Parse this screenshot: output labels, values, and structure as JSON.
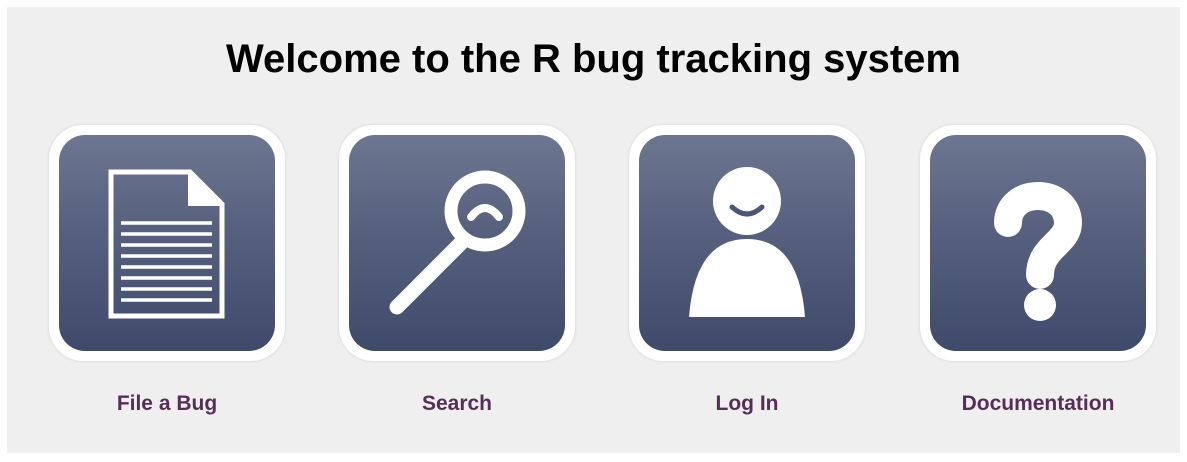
{
  "page": {
    "title": "Welcome to the R bug tracking system"
  },
  "tiles": [
    {
      "label": "File a Bug",
      "icon": "document-icon"
    },
    {
      "label": "Search",
      "icon": "magnifier-icon"
    },
    {
      "label": "Log In",
      "icon": "user-icon"
    },
    {
      "label": "Documentation",
      "icon": "question-mark-icon"
    }
  ],
  "colors": {
    "panel_background": "#efefef",
    "tile_gradient_top": "#6d7690",
    "tile_gradient_bottom": "#3f4a6b",
    "label_color": "#572e57"
  }
}
